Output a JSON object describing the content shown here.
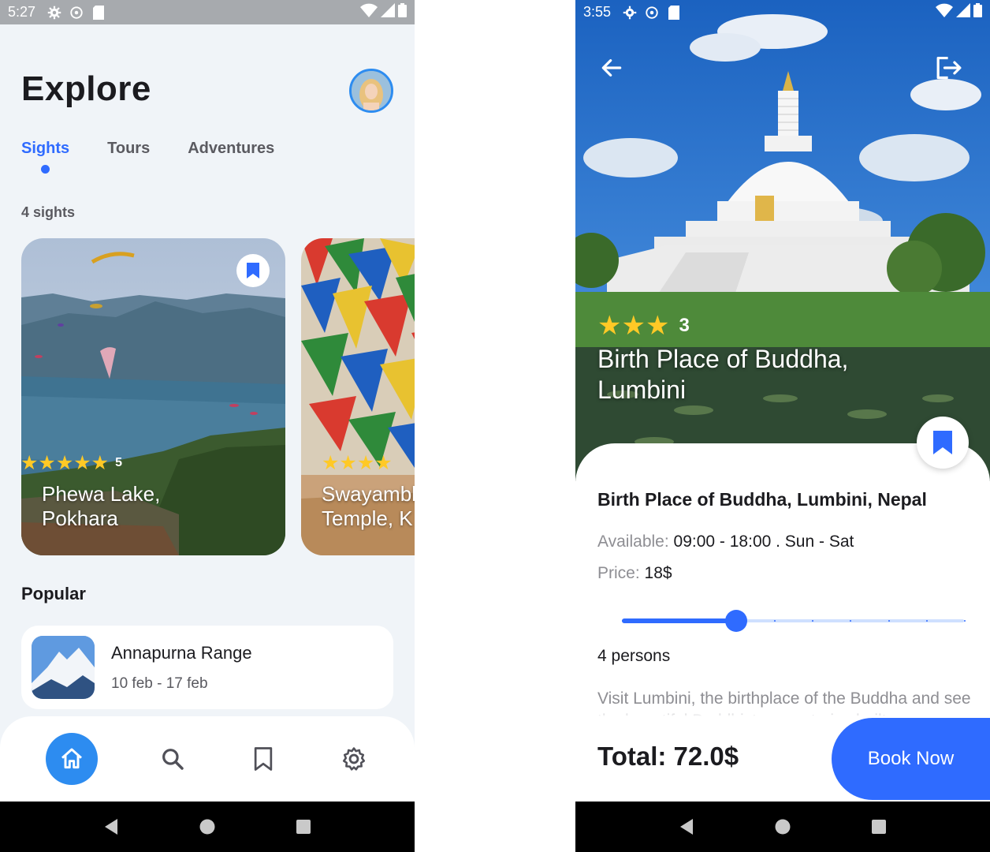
{
  "left_screen": {
    "status_bar": {
      "time": "5:27"
    },
    "page_title": "Explore",
    "tabs": [
      {
        "label": "Sights"
      },
      {
        "label": "Tours"
      },
      {
        "label": "Adventures"
      }
    ],
    "sights_count": "4 sights",
    "cards": [
      {
        "title": "Phewa Lake,\nPokhara",
        "rating": "5",
        "stars": "★★★★★"
      },
      {
        "title": "Swayambhu\nTemple, K",
        "rating": "",
        "stars": "★★★★"
      }
    ],
    "popular_label": "Popular",
    "popular": [
      {
        "name": "Annapurna Range",
        "dates": "10 feb - 17 feb"
      }
    ],
    "bottom_nav": [
      "home-icon",
      "search-icon",
      "bookmark-icon",
      "gear-icon"
    ],
    "colors": {
      "accent": "#2f6bff",
      "nav_active": "#2d8cf0",
      "star": "#ffc926"
    }
  },
  "right_screen": {
    "status_bar": {
      "time": "3:55"
    },
    "rating": "3",
    "stars": "★★★",
    "hero_title": "Birth Place of Buddha,\nLumbini",
    "detail_title": "Birth Place of Buddha, Lumbini, Nepal",
    "available_label": "Available:",
    "available_value": "09:00 - 18:00 . Sun - Sat",
    "price_label": "Price:",
    "price_value": "18$",
    "persons_slider": {
      "value": 4,
      "min": 1,
      "max": 10
    },
    "persons": "4 persons",
    "description": "Visit Lumbini, the birthplace of the Buddha and see the beautiful Buddhist monasteries built",
    "total": "Total: 72.0$",
    "book_button": "Book Now"
  }
}
